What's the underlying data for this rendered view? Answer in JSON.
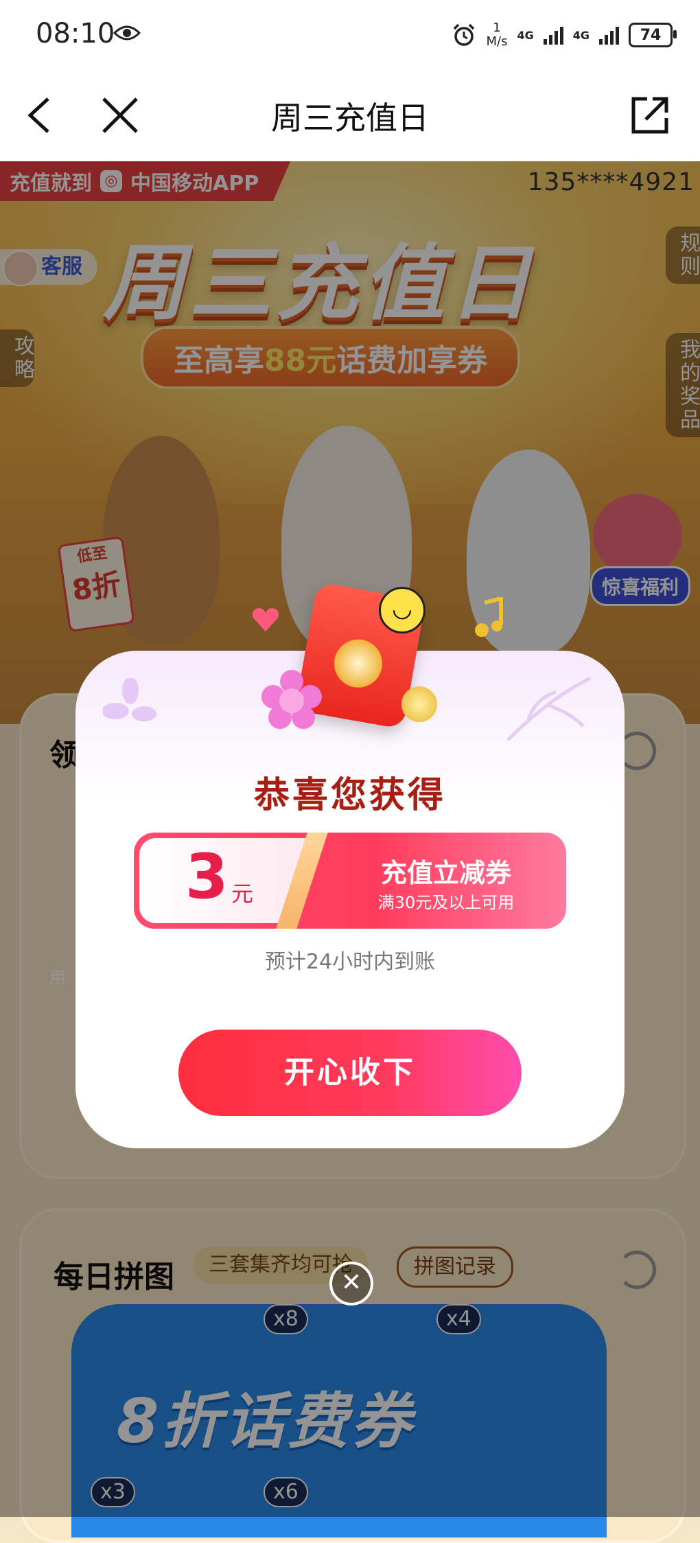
{
  "status_bar": {
    "time": "08:10",
    "speed_value": "1",
    "speed_unit": "M/s",
    "network_1": "4G",
    "network_2": "4G",
    "battery": "74"
  },
  "nav": {
    "title": "周三充值日"
  },
  "hero": {
    "ribbon_text": "充值就到",
    "ribbon_app": "中国移动APP",
    "phone_number": "135****4921",
    "service_label": "客服",
    "rules_label": "规则",
    "guide_label": "攻略",
    "my_prizes_label": "我的奖品",
    "main_title": "周三充值日",
    "subtitle_prefix": "至高享",
    "subtitle_highlight": "88元",
    "subtitle_suffix": "话费加享券",
    "discount_small": "低至",
    "discount_big": "8折",
    "surprise_label": "惊喜福利"
  },
  "section1": {
    "title_fragment": "领",
    "side_text_left": "用"
  },
  "puzzle": {
    "title": "每日拼图",
    "chip_hint": "三套集齐均可抢",
    "record_button": "拼图记录",
    "piece_text": "8折话费券",
    "counts": [
      "x8",
      "x4",
      "x3",
      "x6"
    ]
  },
  "modal": {
    "title": "恭喜您获得",
    "coupon_amount": "3",
    "coupon_unit": "元",
    "coupon_name": "充值立减券",
    "coupon_condition": "满30元及以上可用",
    "eta": "预计24小时内到账",
    "accept_button": "开心收下",
    "close_symbol": "✕"
  },
  "colors": {
    "accent": "#ff2d3d",
    "title_red": "#a81e12",
    "coupon_pink": "#ff3b5c"
  }
}
